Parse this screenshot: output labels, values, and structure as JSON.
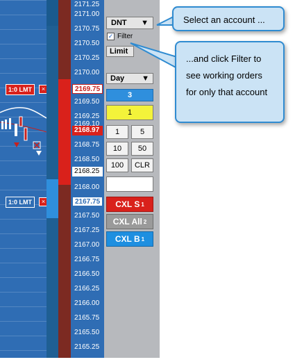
{
  "prices": [
    "2171.25",
    "2171.00",
    "2170.75",
    "2170.50",
    "2170.25",
    "2170.00",
    "2169.75",
    "2169.50",
    "2169.25",
    "2169.10",
    "2168.97",
    "2168.75",
    "2168.50",
    "2168.25",
    "2168.00",
    "2167.75",
    "2167.50",
    "2167.25",
    "2167.00",
    "2166.75",
    "2166.50",
    "2166.25",
    "2166.00",
    "2165.75",
    "2165.50",
    "2165.25"
  ],
  "ladder": {
    "highlight_red": "2169.75",
    "last_trade": "2168.97",
    "current": "2168.25",
    "highlight_blue": "2167.75"
  },
  "orders": [
    {
      "label": "1:0 LMT",
      "close": "×",
      "color": "#d9211b"
    },
    {
      "label": "1:0 LMT",
      "close": "×",
      "color": "#2f6db4"
    }
  ],
  "panel": {
    "account": "DNT",
    "account_arrow": "▼",
    "filter_label": "Filter",
    "filter_checked": true,
    "order_type": "Limit",
    "duration": "Day",
    "duration_arrow": "▼",
    "qty_display": "3",
    "qty_yellow": "1",
    "qty_buttons": [
      "1",
      "5",
      "10",
      "50",
      "100",
      "CLR"
    ],
    "cxl_sell": "CXL S",
    "cxl_sell_count": "1",
    "cxl_all": "CXL All",
    "cxl_all_count": "2",
    "cxl_buy": "CXL B",
    "cxl_buy_count": "1"
  },
  "callouts": {
    "select": "Select an account ...",
    "filter": "...and click Filter to see working orders for only that account"
  }
}
